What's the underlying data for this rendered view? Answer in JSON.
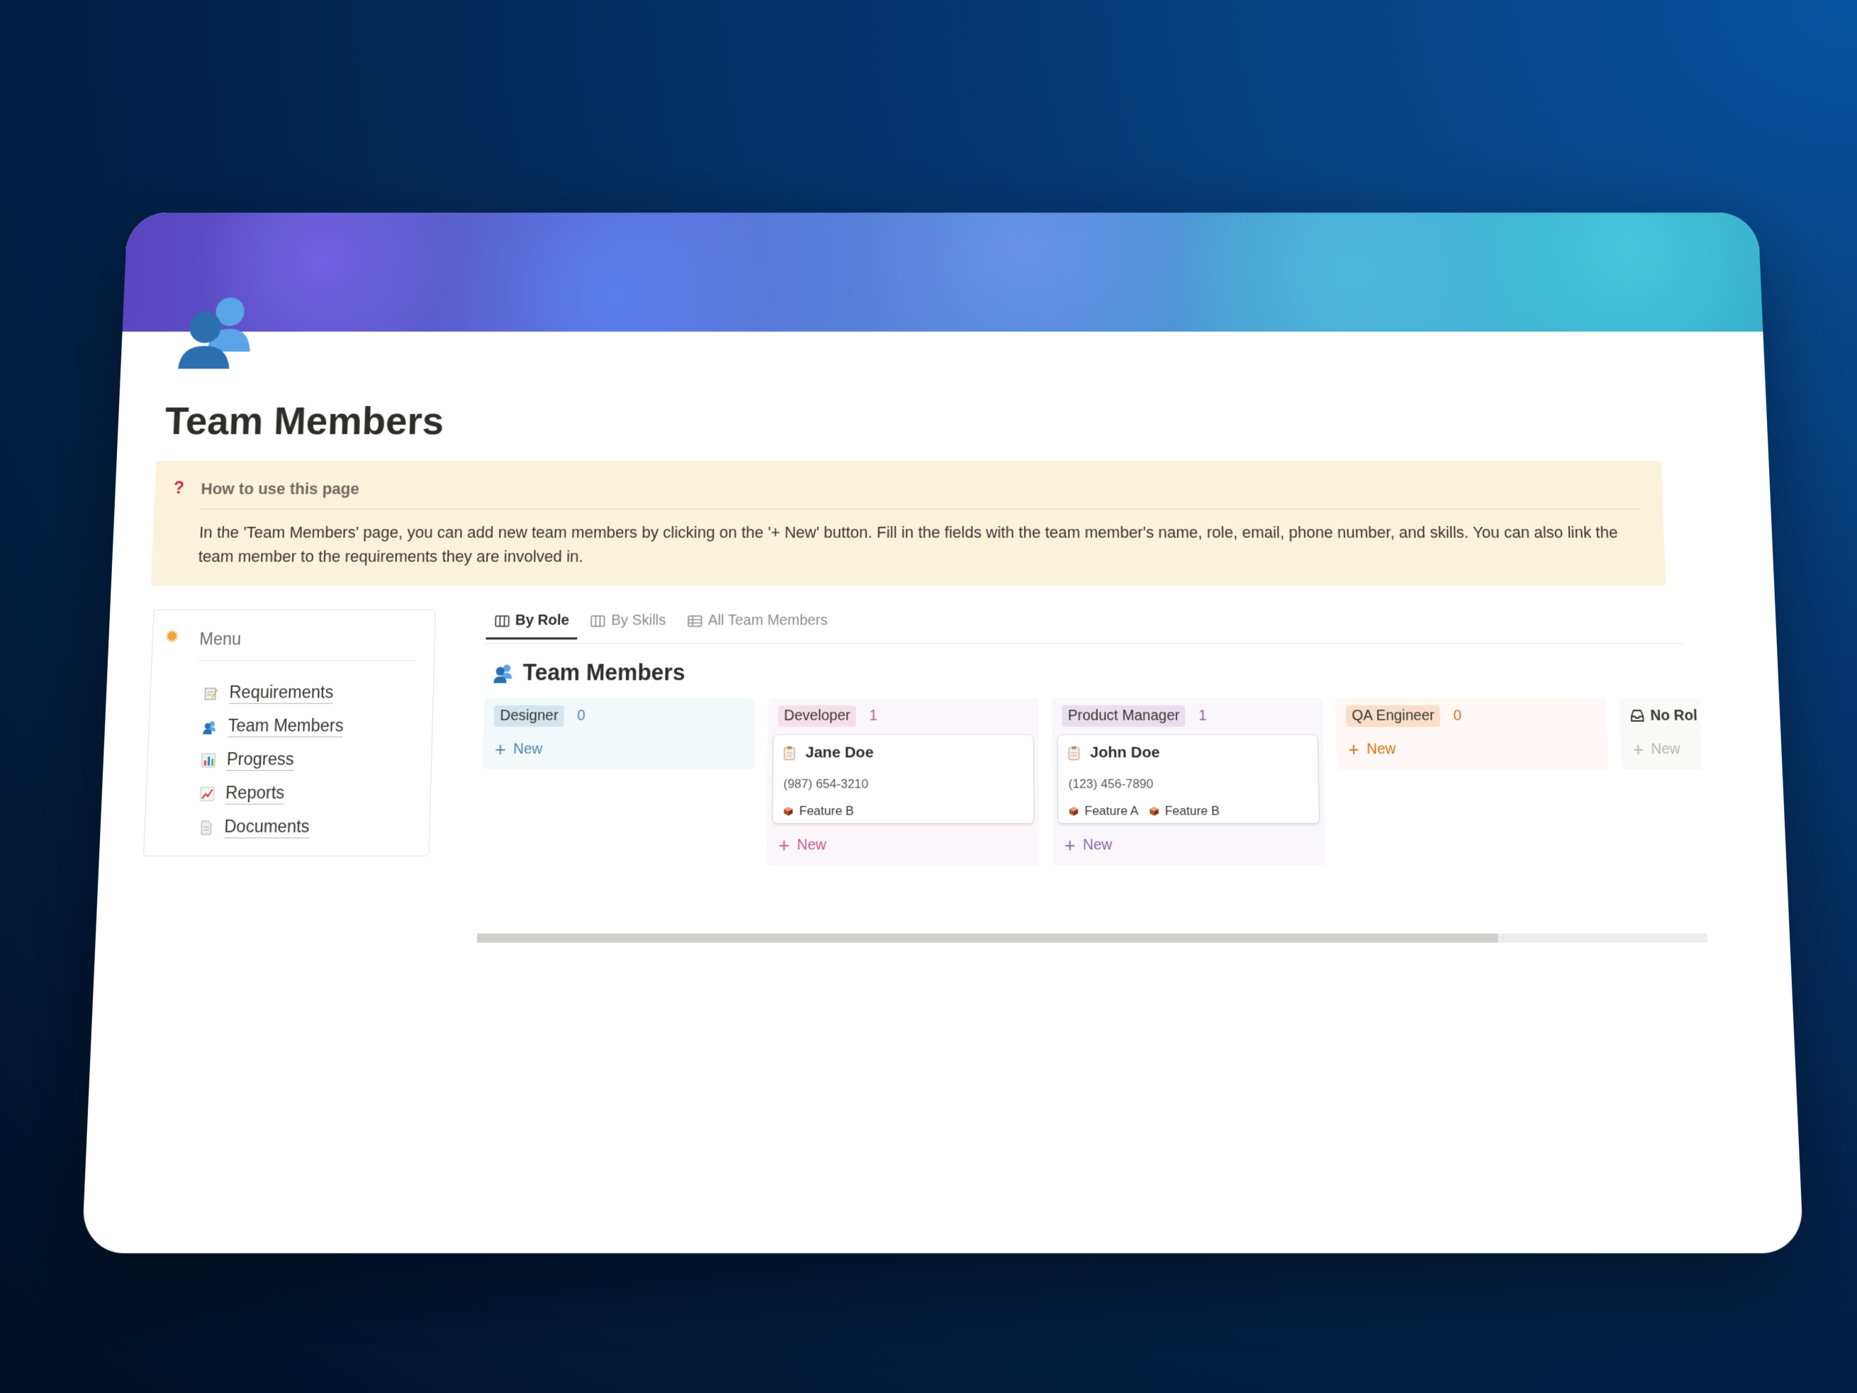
{
  "page": {
    "title": "Team Members",
    "icon": "team-members-icon"
  },
  "callout": {
    "icon": "question-mark-icon",
    "heading": "How to use this page",
    "body": "In the 'Team Members' page, you can add new team members by clicking on the '+ New' button. Fill in the fields with the team member's name, role, email, phone number, and skills. You can also link the team member to the requirements they are involved in."
  },
  "menu": {
    "title": "Menu",
    "icon": "sun-icon",
    "items": [
      {
        "label": "Requirements",
        "icon": "memo-icon"
      },
      {
        "label": "Team Members",
        "icon": "team-members-icon"
      },
      {
        "label": "Progress",
        "icon": "bar-chart-icon"
      },
      {
        "label": "Reports",
        "icon": "trend-chart-icon"
      },
      {
        "label": "Documents",
        "icon": "page-icon"
      }
    ]
  },
  "views": {
    "tabs": [
      {
        "label": "By Role",
        "icon": "board-icon",
        "active": true
      },
      {
        "label": "By Skills",
        "icon": "board-icon",
        "active": false
      },
      {
        "label": "All Team Members",
        "icon": "table-icon",
        "active": false
      }
    ]
  },
  "database": {
    "title": "Team Members",
    "icon": "team-members-icon",
    "new_label": "New",
    "columns": [
      {
        "name": "Designer",
        "count": "0",
        "colors": {
          "bg": "#f3f8fb",
          "tag": "#d3e5ef",
          "accent": "#4d87b0"
        },
        "cards": []
      },
      {
        "name": "Developer",
        "count": "1",
        "colors": {
          "bg": "#fbf6fa",
          "tag": "#f5e0e9",
          "accent": "#c4588b"
        },
        "cards": [
          {
            "name": "Jane Doe",
            "phone": "(987) 654-3210",
            "features": [
              "Feature B"
            ]
          }
        ]
      },
      {
        "name": "Product Manager",
        "count": "1",
        "colors": {
          "bg": "#f9f6fc",
          "tag": "#e8deee",
          "accent": "#8a63a8"
        },
        "cards": [
          {
            "name": "John Doe",
            "phone": "(123) 456-7890",
            "features": [
              "Feature A",
              "Feature B"
            ]
          }
        ]
      },
      {
        "name": "QA Engineer",
        "count": "0",
        "colors": {
          "bg": "#fdf8f5",
          "tag": "#fadec9",
          "accent": "#d9730d"
        },
        "cards": []
      },
      {
        "name": "No Rol",
        "count": "",
        "colors": {
          "bg": "#f9f9f8",
          "tag": "transparent",
          "accent": "#b4b3b0"
        },
        "cards": []
      }
    ]
  },
  "scrollbar": {
    "position": 0.83
  }
}
